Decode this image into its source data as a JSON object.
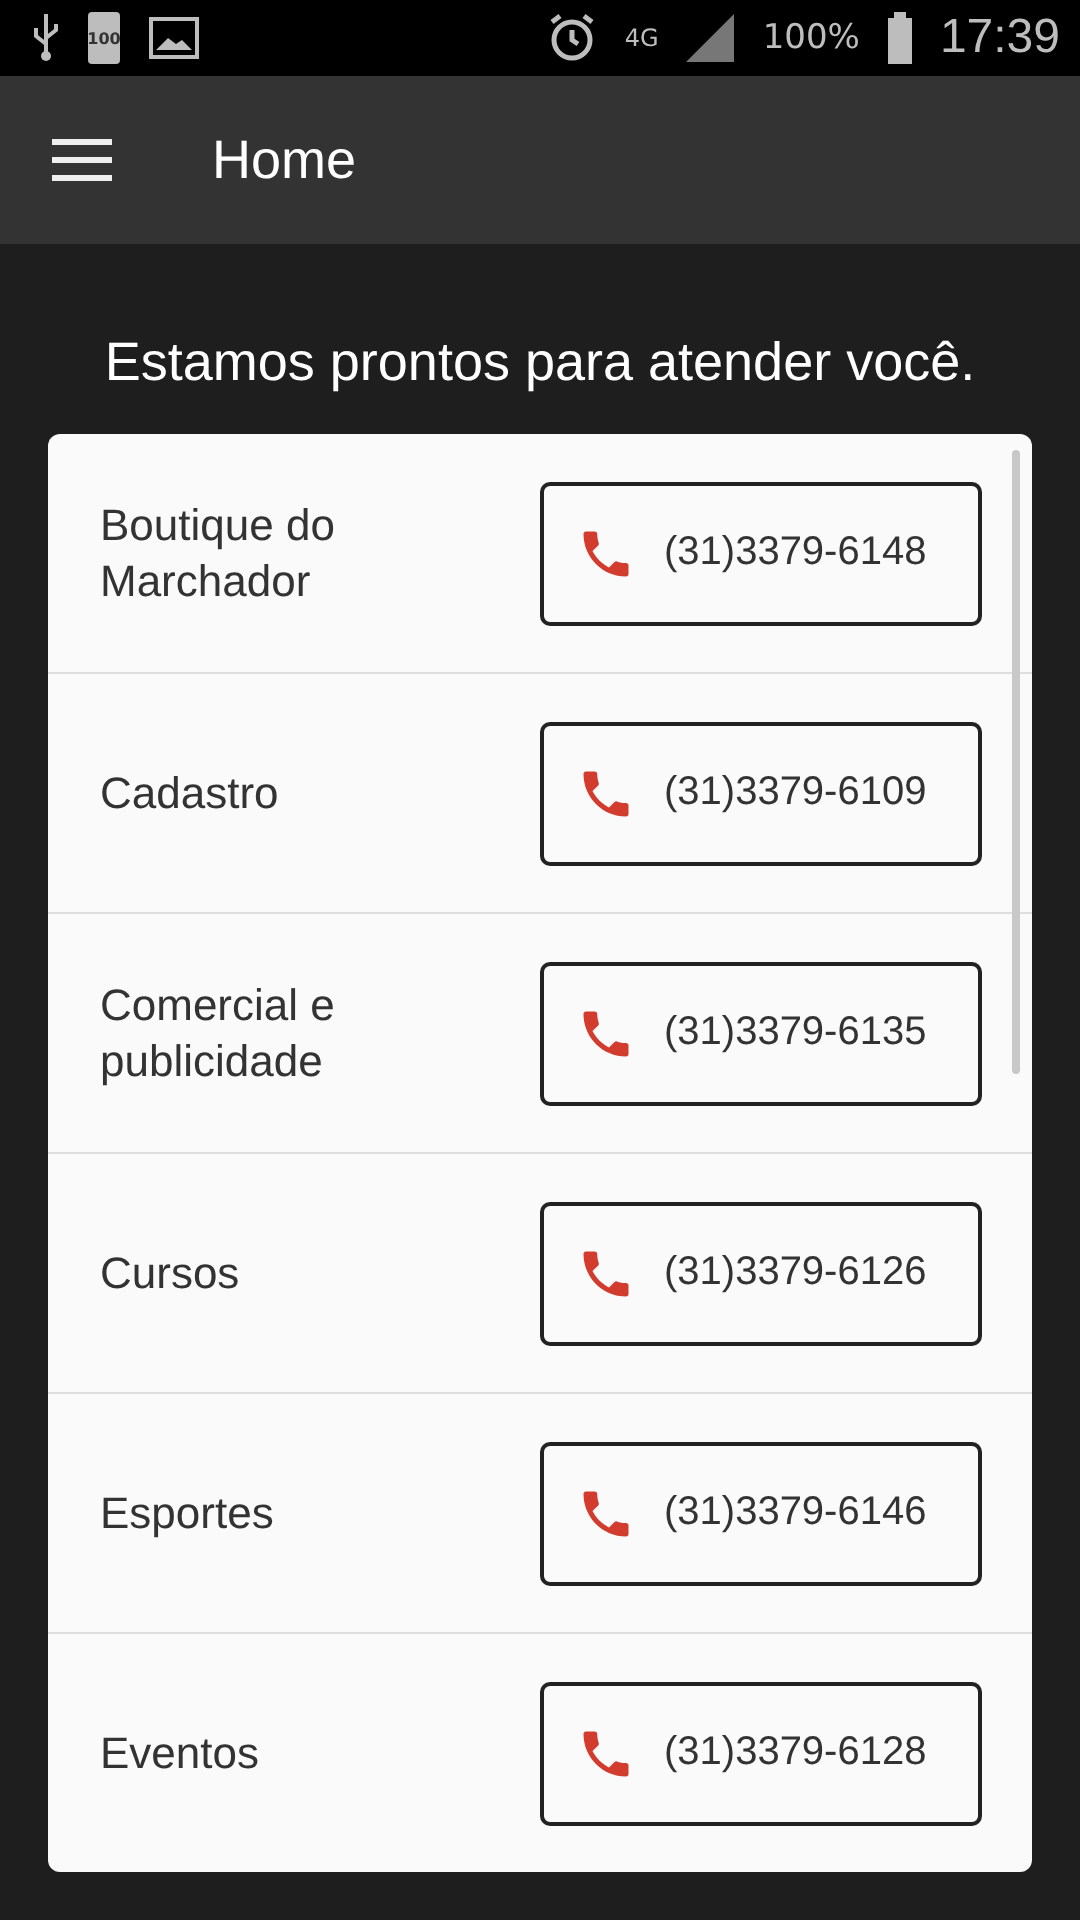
{
  "status_bar": {
    "battery_icon_text": "100",
    "network": "4G",
    "battery": "100%",
    "time": "17:39"
  },
  "app_bar": {
    "title": "Home"
  },
  "heading": "Estamos prontos para atender você.",
  "contacts": [
    {
      "name": "Boutique do Marchador",
      "phone": "(31)3379-6148"
    },
    {
      "name": "Cadastro",
      "phone": "(31)3379-6109"
    },
    {
      "name": "Comercial e publicidade",
      "phone": "(31)3379-6135"
    },
    {
      "name": "Cursos",
      "phone": "(31)3379-6126"
    },
    {
      "name": "Esportes",
      "phone": "(31)3379-6146"
    },
    {
      "name": "Eventos",
      "phone": "(31)3379-6128"
    }
  ]
}
